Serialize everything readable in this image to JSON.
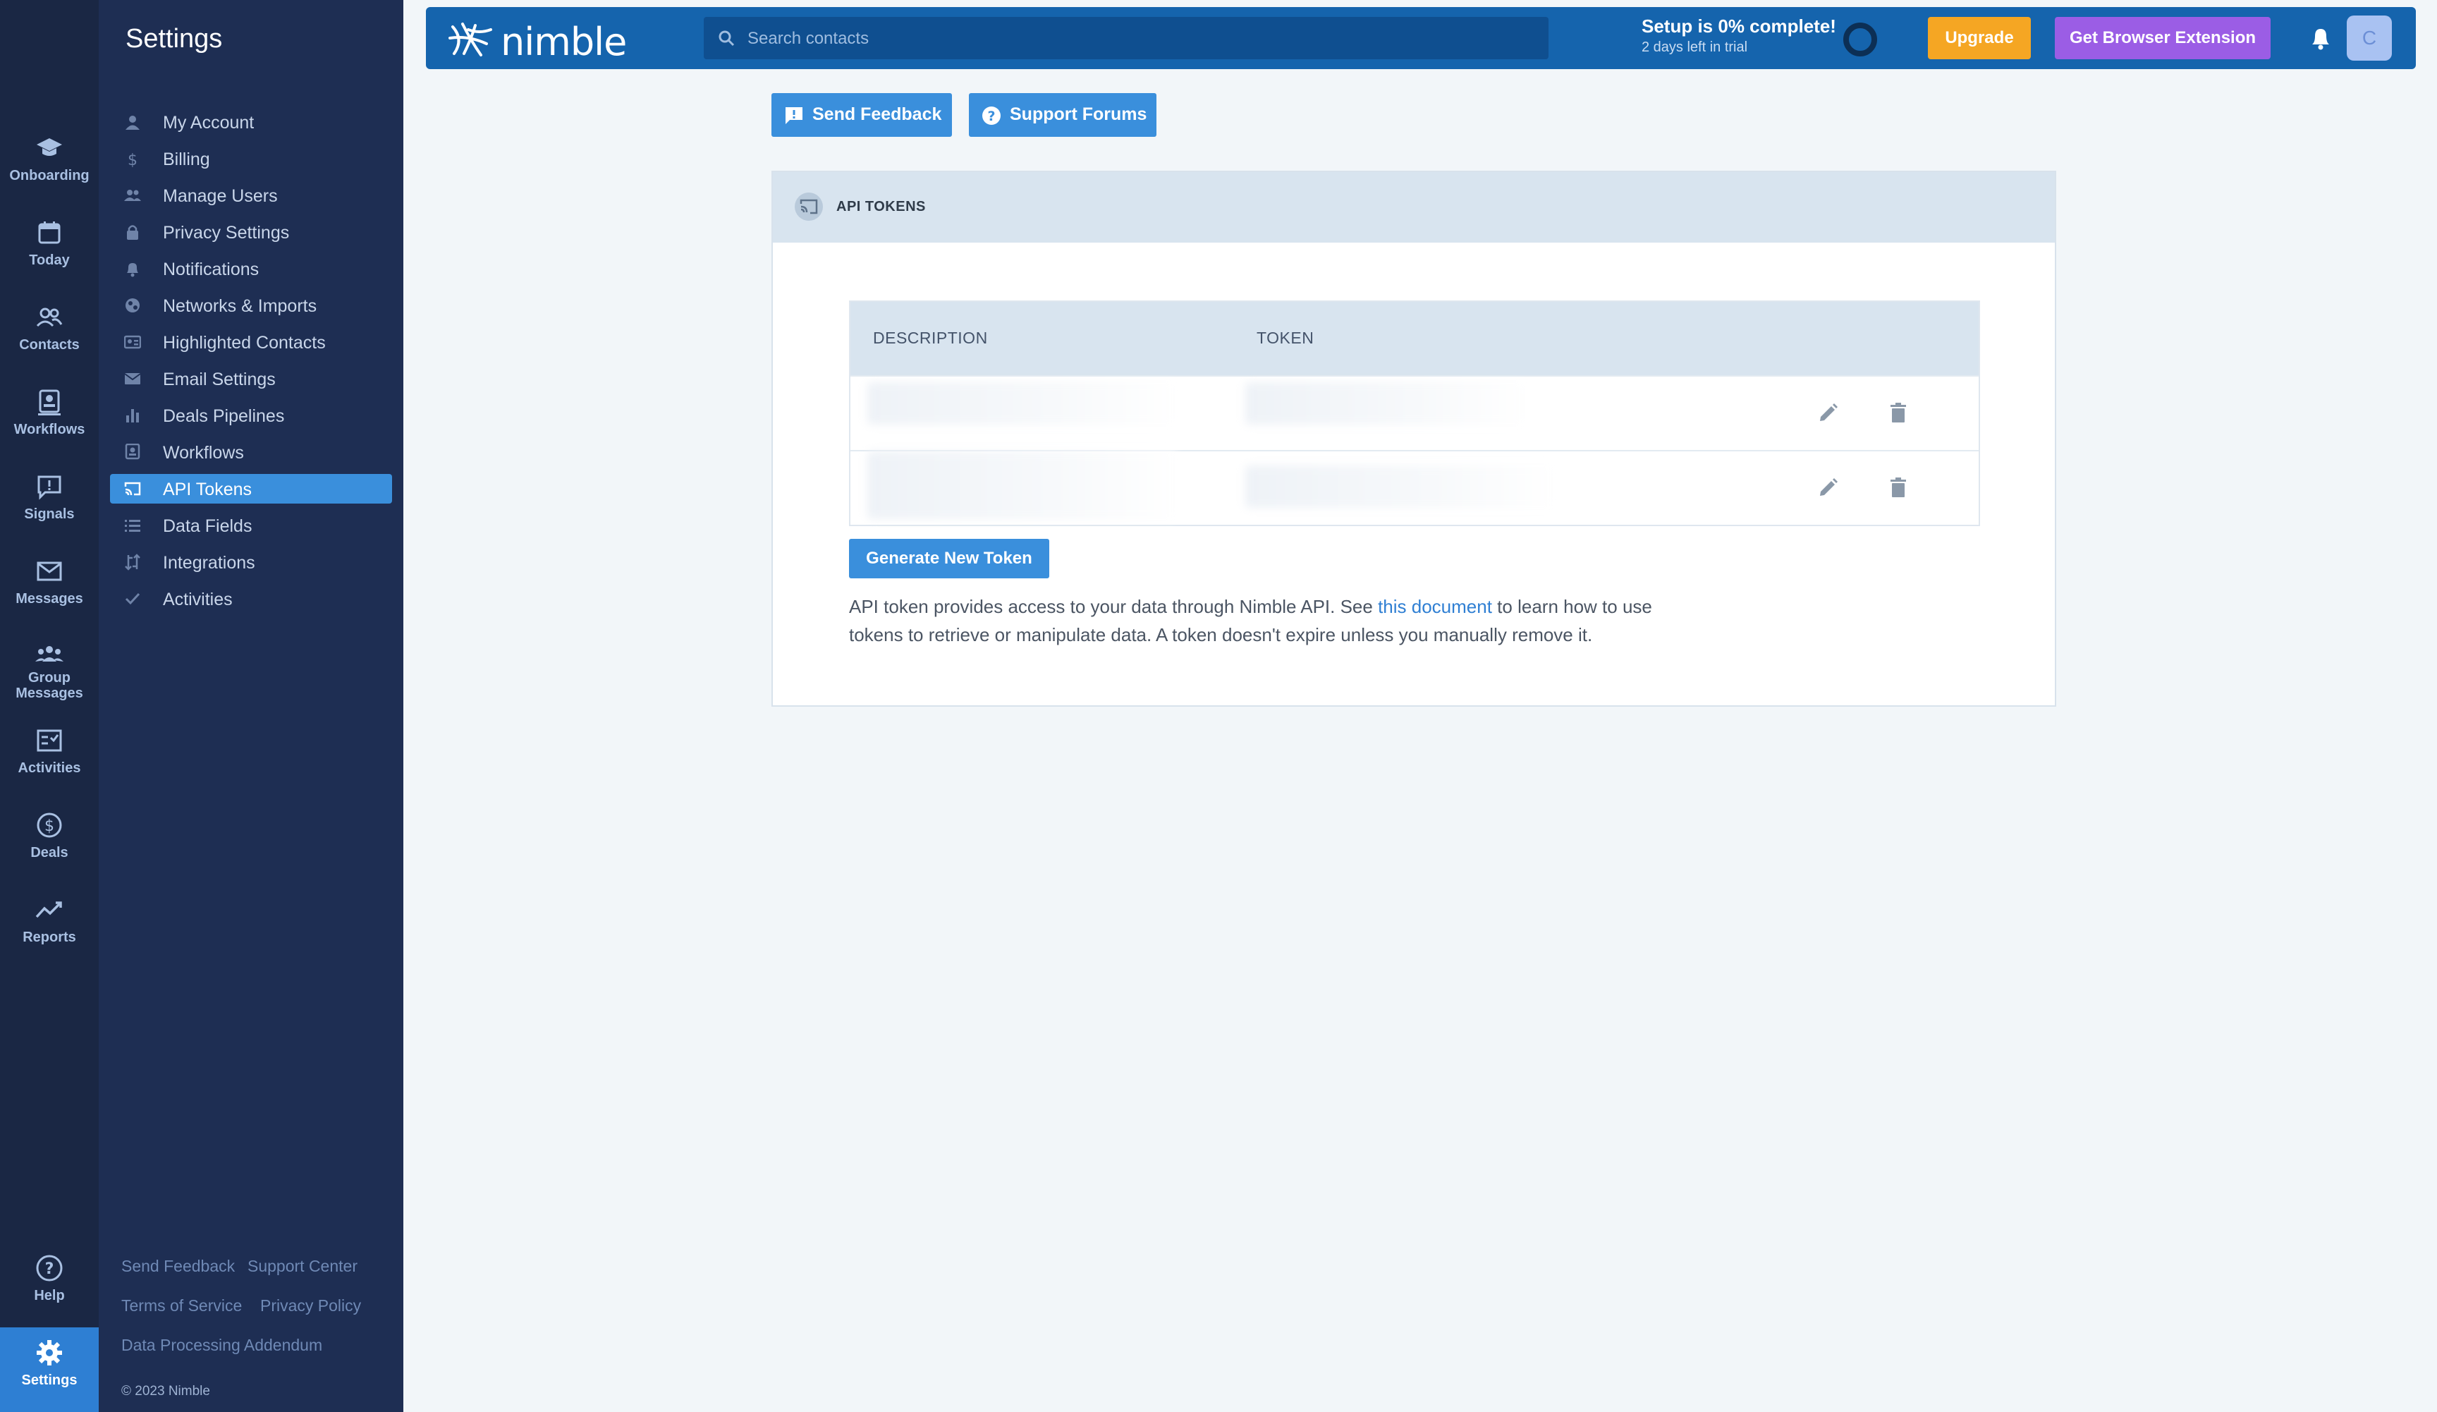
{
  "rail": {
    "items": [
      {
        "label": "Onboarding",
        "icon": "graduation-cap-icon"
      },
      {
        "label": "Today",
        "icon": "calendar-icon"
      },
      {
        "label": "Contacts",
        "icon": "contacts-icon"
      },
      {
        "label": "Workflows",
        "icon": "workflow-icon"
      },
      {
        "label": "Signals",
        "icon": "signal-alert-icon"
      },
      {
        "label": "Messages",
        "icon": "envelope-icon"
      },
      {
        "label": "Group Messages",
        "icon": "group-icon"
      },
      {
        "label": "Activities",
        "icon": "checklist-icon"
      },
      {
        "label": "Deals",
        "icon": "dollar-circle-icon"
      },
      {
        "label": "Reports",
        "icon": "trend-line-icon"
      }
    ],
    "help": {
      "label": "Help",
      "icon": "help-circle-icon"
    },
    "settings": {
      "label": "Settings",
      "icon": "gear-icon"
    }
  },
  "settings_panel": {
    "title": "Settings",
    "items": [
      {
        "label": "My Account",
        "icon": "person-icon"
      },
      {
        "label": "Billing",
        "icon": "dollar-icon"
      },
      {
        "label": "Manage Users",
        "icon": "people-icon"
      },
      {
        "label": "Privacy Settings",
        "icon": "lock-icon"
      },
      {
        "label": "Notifications",
        "icon": "bell-icon"
      },
      {
        "label": "Networks & Imports",
        "icon": "globe-icon"
      },
      {
        "label": "Highlighted Contacts",
        "icon": "id-card-icon"
      },
      {
        "label": "Email Settings",
        "icon": "envelope-icon"
      },
      {
        "label": "Deals Pipelines",
        "icon": "bar-chart-icon"
      },
      {
        "label": "Workflows",
        "icon": "workflow-icon"
      },
      {
        "label": "API Tokens",
        "icon": "cast-icon",
        "active": true
      },
      {
        "label": "Data Fields",
        "icon": "list-icon"
      },
      {
        "label": "Integrations",
        "icon": "integration-icon"
      },
      {
        "label": "Activities",
        "icon": "check-icon"
      }
    ],
    "footer": {
      "send_feedback": "Send Feedback",
      "support_center": "Support Center",
      "terms": "Terms of Service",
      "privacy": "Privacy Policy",
      "dpa": "Data Processing Addendum",
      "copyright": "© 2023 Nimble"
    }
  },
  "topbar": {
    "logo": "nimble",
    "search_placeholder": "Search contacts",
    "setup_title": "Setup is 0% complete!",
    "setup_sub": "2 days left in trial",
    "setup_progress": 0,
    "upgrade": "Upgrade",
    "extension": "Get Browser Extension",
    "avatar_initial": "C"
  },
  "actions": {
    "send_feedback": "Send Feedback",
    "support_forums": "Support Forums"
  },
  "card": {
    "title": "API TOKENS",
    "columns": [
      "DESCRIPTION",
      "TOKEN"
    ],
    "generate": "Generate New Token",
    "help_before": "API token provides access to your data through Nimble API. See ",
    "help_link": "this document",
    "help_after": " to learn how to use tokens to retrieve or manipulate data. A token doesn't expire unless you manually remove it."
  },
  "colors": {
    "rail_bg": "#1a2744",
    "panel_bg": "#1e2e53",
    "topbar_bg": "#1564ad",
    "accent": "#3a8fdc",
    "upgrade": "#f5a623",
    "extension": "#9b5de5"
  }
}
